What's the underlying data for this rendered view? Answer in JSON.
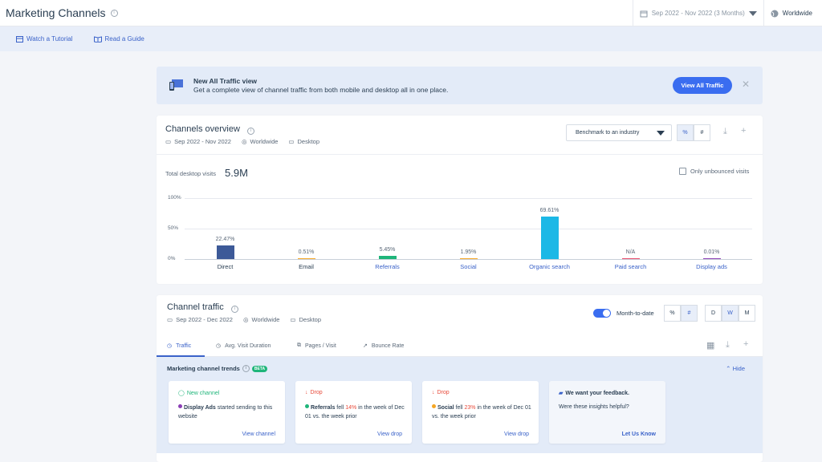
{
  "header": {
    "title": "Marketing Channels",
    "date_range": "Sep 2022 - Nov 2022 (3 Months)",
    "country": "Worldwide"
  },
  "subbar": {
    "tutorial": "Watch a Tutorial",
    "guide": "Read a Guide"
  },
  "banner": {
    "title": "New All Traffic view",
    "description": "Get a complete view of channel traffic from both mobile and desktop all in one place.",
    "button": "View All Traffic"
  },
  "overview": {
    "title": "Channels overview",
    "date": "Sep 2022 - Nov 2022",
    "country": "Worldwide",
    "device": "Desktop",
    "benchmark": "Benchmark to an industry",
    "toggle_pct": "%",
    "toggle_num": "#",
    "total_label": "Total desktop visits",
    "total_value": "5.9M",
    "unbounced_label": "Only unbounced visits"
  },
  "chart_data": {
    "type": "bar",
    "categories": [
      "Direct",
      "Email",
      "Referrals",
      "Social",
      "Organic search",
      "Paid search",
      "Display ads"
    ],
    "values": [
      22.47,
      0.51,
      5.45,
      1.95,
      69.61,
      null,
      0.01
    ],
    "labels": [
      "22.47%",
      "0.51%",
      "5.45%",
      "1.95%",
      "69.61%",
      "N/A",
      "0.01%"
    ],
    "colors": [
      "#3d5a98",
      "#f5a623",
      "#1fb57a",
      "#f5a623",
      "#1cb8e6",
      "#e84a6a",
      "#8b3fb5"
    ],
    "ylim": [
      0,
      100
    ],
    "yticks": [
      "100%",
      "50%",
      "0%"
    ]
  },
  "traffic": {
    "title": "Channel traffic",
    "date": "Sep 2022 - Dec 2022",
    "country": "Worldwide",
    "device": "Desktop",
    "mtd_label": "Month-to-date",
    "toggle_pct": "%",
    "toggle_num": "#",
    "gran_d": "D",
    "gran_w": "W",
    "gran_m": "M",
    "tabs": [
      "Traffic",
      "Avg. Visit Duration",
      "Pages / Visit",
      "Bounce Rate"
    ]
  },
  "trends": {
    "title": "Marketing channel trends",
    "beta": "BETA",
    "hide": "Hide",
    "cards": [
      {
        "header": "New channel",
        "channel": "Display Ads",
        "text": " started sending to this website",
        "link": "View channel"
      },
      {
        "header": "Drop",
        "channel": "Referrals",
        "pre": " fell ",
        "pct": "14%",
        "post": " in the week of Dec 01 vs. the week prior",
        "link": "View drop"
      },
      {
        "header": "Drop",
        "channel": "Social",
        "pre": " fell ",
        "pct": "23%",
        "post": " in the week of Dec 01 vs. the week prior",
        "link": "View drop"
      }
    ],
    "feedback": {
      "title": "We want your feedback.",
      "question": "Were these insights helpful?",
      "link": "Let Us Know"
    }
  }
}
